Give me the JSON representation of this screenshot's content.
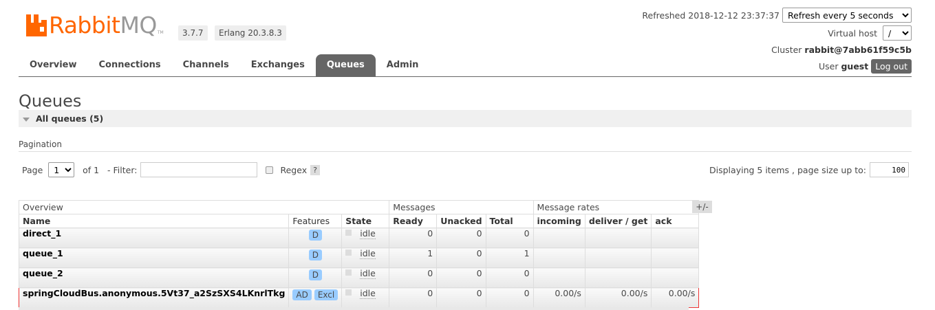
{
  "header": {
    "logo": {
      "rabbit": "Rabbit",
      "mq": "MQ",
      "tm": "TM"
    },
    "version": "3.7.7",
    "erlang": "Erlang 20.3.8.3",
    "refreshed_label": "Refreshed",
    "refreshed_time": "2018-12-12 23:37:37",
    "refresh_select": "Refresh every 5 seconds",
    "virtual_host_label": "Virtual host",
    "virtual_host_value": "/",
    "cluster_label": "Cluster",
    "cluster_name": "rabbit@7abb61f59c5b",
    "user_label": "User",
    "user_name": "guest",
    "logout": "Log out"
  },
  "nav": {
    "tabs": [
      "Overview",
      "Connections",
      "Channels",
      "Exchanges",
      "Queues",
      "Admin"
    ],
    "active": "Queues"
  },
  "page_title": "Queues",
  "section": {
    "label": "All queues (5)"
  },
  "pagination": {
    "label": "Pagination",
    "page_label": "Page",
    "page_value": "1",
    "of_label": "of 1",
    "filter_label": "- Filter:",
    "filter_value": "",
    "regex_label": "Regex",
    "help": "?",
    "displaying": "Displaying 5 items , page size up to:",
    "page_size": "100"
  },
  "table": {
    "groups": [
      "Overview",
      "Messages",
      "Message rates"
    ],
    "toggle": "+/-",
    "columns": [
      "Name",
      "Features",
      "State",
      "Ready",
      "Unacked",
      "Total",
      "incoming",
      "deliver / get",
      "ack"
    ],
    "rows": [
      {
        "name": "direct_1",
        "features": [
          "D"
        ],
        "state": "idle",
        "ready": "0",
        "unacked": "0",
        "total": "0",
        "incoming": "",
        "deliver": "",
        "ack": ""
      },
      {
        "name": "queue_1",
        "features": [
          "D"
        ],
        "state": "idle",
        "ready": "1",
        "unacked": "0",
        "total": "1",
        "incoming": "",
        "deliver": "",
        "ack": ""
      },
      {
        "name": "queue_2",
        "features": [
          "D"
        ],
        "state": "idle",
        "ready": "0",
        "unacked": "0",
        "total": "0",
        "incoming": "",
        "deliver": "",
        "ack": ""
      },
      {
        "name": "springCloudBus.anonymous.5Vt37_a2SzSXS4LKnrlTkg",
        "features": [
          "AD",
          "Excl"
        ],
        "state": "idle",
        "ready": "0",
        "unacked": "0",
        "total": "0",
        "incoming": "0.00/s",
        "deliver": "0.00/s",
        "ack": "0.00/s"
      }
    ]
  },
  "colors": {
    "brand_orange": "#ff6600",
    "tab_active": "#666666",
    "feature_badge": "#99ccff",
    "highlight": "#ee3333"
  }
}
